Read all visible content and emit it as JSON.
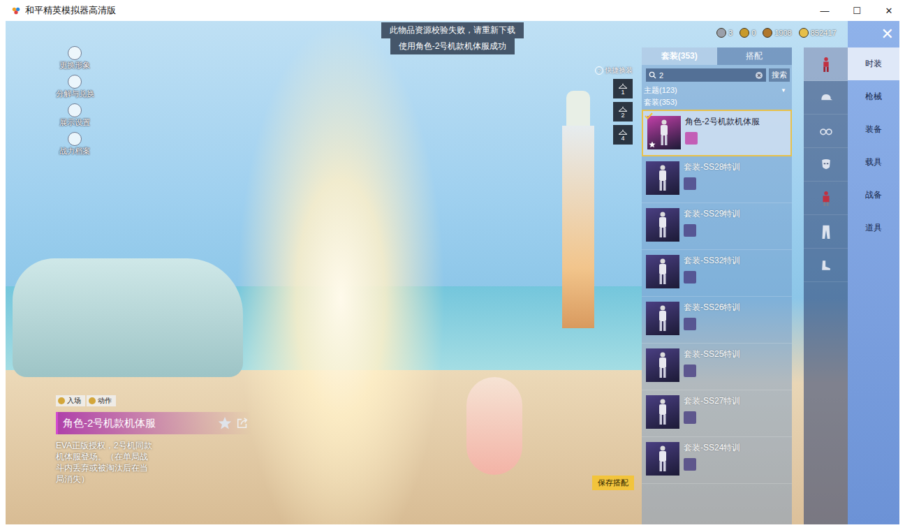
{
  "window": {
    "title": "和平精英模拟器高清版",
    "controls": [
      "—",
      "☐",
      "✕"
    ]
  },
  "notices": [
    "此物品资源校验失败，请重新下载",
    "使用角色-2号机款机体服成功"
  ],
  "currencies": [
    {
      "amount": "3",
      "color": "#9aa0aa"
    },
    {
      "amount": "0",
      "color": "#c89a2a"
    },
    {
      "amount": "1908",
      "color": "#b0772c"
    },
    {
      "amount": "852417",
      "color": "#e6bf4a"
    }
  ],
  "close": "✕",
  "side_menu": [
    "更换形象",
    "分解与兑换",
    "展示设置",
    "战力档案"
  ],
  "quick_swap": {
    "title": "快捷换装",
    "help": "?",
    "slots": [
      "1",
      "2",
      "4"
    ]
  },
  "outfit_panel": {
    "tabs": [
      {
        "label": "套装(353)",
        "selected": true
      },
      {
        "label": "搭配",
        "selected": false
      }
    ],
    "search": {
      "value": "2",
      "button": "搜索"
    },
    "filter": {
      "label": "主题(123)",
      "arrow": "▼"
    },
    "section": "套装(353)",
    "items": [
      {
        "name": "角色-2号机款机体服",
        "selected": true,
        "favorite": true,
        "color": "#c23fa8"
      },
      {
        "name": "套装-SS28特训",
        "selected": false,
        "favorite": false,
        "color": "#4a3f82"
      },
      {
        "name": "套装-SS29特训",
        "selected": false,
        "favorite": false,
        "color": "#4a3f82"
      },
      {
        "name": "套装-SS32特训",
        "selected": false,
        "favorite": false,
        "color": "#4a3f82"
      },
      {
        "name": "套装-SS26特训",
        "selected": false,
        "favorite": false,
        "color": "#4a3f82"
      },
      {
        "name": "套装-SS25特训",
        "selected": false,
        "favorite": false,
        "color": "#4a3f82"
      },
      {
        "name": "套装-SS27特训",
        "selected": false,
        "favorite": false,
        "color": "#4a3f82"
      },
      {
        "name": "套装-SS24特训",
        "selected": false,
        "favorite": false,
        "color": "#4a3f82"
      }
    ]
  },
  "categories": [
    {
      "kind": "outfit",
      "selected": true
    },
    {
      "kind": "hat",
      "selected": false
    },
    {
      "kind": "glasses",
      "selected": false
    },
    {
      "kind": "mask",
      "selected": false
    },
    {
      "kind": "top",
      "selected": false
    },
    {
      "kind": "pants",
      "selected": false
    },
    {
      "kind": "shoes",
      "selected": false
    }
  ],
  "main_menu": [
    {
      "label": "时装",
      "selected": true
    },
    {
      "label": "枪械",
      "selected": false
    },
    {
      "label": "装备",
      "selected": false
    },
    {
      "label": "载具",
      "selected": false
    },
    {
      "label": "战备",
      "selected": false
    },
    {
      "label": "道具",
      "selected": false
    }
  ],
  "detail": {
    "actions": [
      "入场",
      "动作"
    ],
    "name": "角色-2号机款机体服",
    "description": "EVA正版授权，2号机同款机体服登场。（在单局战斗内丢弃或被淘汰后在当局消失）"
  },
  "save_button": "保存搭配"
}
